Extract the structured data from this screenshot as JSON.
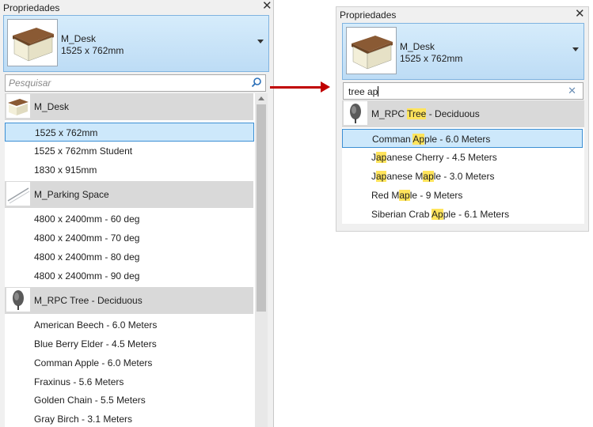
{
  "left": {
    "title": "Propriedades",
    "close": "✕",
    "header": {
      "name": "M_Desk",
      "size": "1525 x 762mm"
    },
    "search": {
      "placeholder": "Pesquisar",
      "icon": "search-icon"
    },
    "groups": [
      {
        "label": "M_Desk",
        "thumb": "desk",
        "items": [
          "1525 x 762mm",
          "1525 x 762mm Student",
          "1830 x 915mm"
        ]
      },
      {
        "label": "M_Parking Space",
        "thumb": "parking",
        "items": [
          "4800 x 2400mm - 60 deg",
          "4800 x 2400mm - 70 deg",
          "4800 x 2400mm - 80 deg",
          "4800 x 2400mm - 90 deg"
        ]
      },
      {
        "label": "M_RPC Tree - Deciduous",
        "thumb": "tree",
        "items": [
          "American Beech - 6.0 Meters",
          "Blue Berry Elder - 4.5 Meters",
          "Comman Apple - 6.0 Meters",
          "Fraxinus - 5.6 Meters",
          "Golden Chain - 5.5 Meters",
          "Gray Birch - 3.1 Meters"
        ]
      }
    ],
    "selected_item": "1525 x 762mm"
  },
  "right": {
    "title": "Propriedades",
    "close": "✕",
    "header": {
      "name": "M_Desk",
      "size": "1525 x 762mm"
    },
    "search": {
      "query": "tree ap",
      "clear": "✕"
    },
    "group": {
      "label_parts": [
        {
          "t": "M_RPC ",
          "h": false
        },
        {
          "t": "Tree",
          "h": true
        },
        {
          "t": " - Deciduous",
          "h": false
        }
      ]
    },
    "items": [
      [
        {
          "t": "Comman ",
          "h": false
        },
        {
          "t": "Ap",
          "h": true
        },
        {
          "t": "ple - 6.0 Meters",
          "h": false
        }
      ],
      [
        {
          "t": "J",
          "h": false
        },
        {
          "t": "ap",
          "h": true
        },
        {
          "t": "anese Cherry - 4.5 Meters",
          "h": false
        }
      ],
      [
        {
          "t": "J",
          "h": false
        },
        {
          "t": "ap",
          "h": true
        },
        {
          "t": "anese M",
          "h": false
        },
        {
          "t": "ap",
          "h": true
        },
        {
          "t": "le - 3.0 Meters",
          "h": false
        }
      ],
      [
        {
          "t": "Red M",
          "h": false
        },
        {
          "t": "ap",
          "h": true
        },
        {
          "t": "le - 9 Meters",
          "h": false
        }
      ],
      [
        {
          "t": "Siberian Crab ",
          "h": false
        },
        {
          "t": "Ap",
          "h": true
        },
        {
          "t": "ple - 6.1 Meters",
          "h": false
        }
      ]
    ]
  },
  "colors": {
    "arrow": "#c00000",
    "highlight": "#ffe45c",
    "selection": "#cde8fb",
    "selection_border": "#3c8fd4",
    "header_bg": "#bddcf5"
  }
}
